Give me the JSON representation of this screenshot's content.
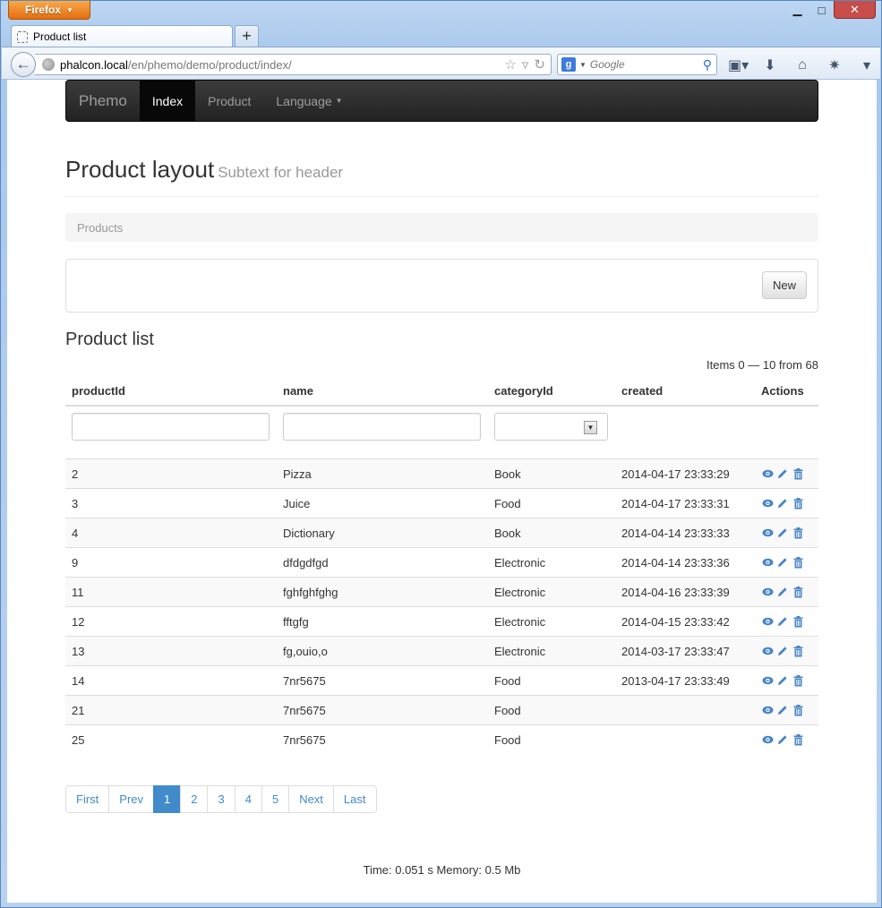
{
  "browser": {
    "menu_label": "Firefox",
    "tab_title": "Product list",
    "url_host": "phalcon.local",
    "url_path": "/en/phemo/demo/product/index/",
    "search_placeholder": "Google",
    "search_engine_letter": "g"
  },
  "navbar": {
    "brand": "Phemo",
    "items": [
      {
        "label": "Index",
        "active": true
      },
      {
        "label": "Product",
        "active": false
      },
      {
        "label": "Language",
        "active": false
      }
    ]
  },
  "header": {
    "title": "Product layout",
    "subtitle": "Subtext for header"
  },
  "breadcrumb": "Products",
  "toolbar": {
    "new_label": "New"
  },
  "list": {
    "title": "Product list",
    "items_info": "Items 0 — 10 from 68",
    "columns": [
      "productId",
      "name",
      "categoryId",
      "created",
      "Actions"
    ],
    "rows": [
      {
        "id": "2",
        "name": "Pizza",
        "category": "Book",
        "created": "2014-04-17 23:33:29"
      },
      {
        "id": "3",
        "name": "Juice",
        "category": "Food",
        "created": "2014-04-17 23:33:31"
      },
      {
        "id": "4",
        "name": "Dictionary",
        "category": "Book",
        "created": "2014-04-14 23:33:33"
      },
      {
        "id": "9",
        "name": "dfdgdfgd",
        "category": "Electronic",
        "created": "2014-04-14 23:33:36"
      },
      {
        "id": "11",
        "name": "fghfghfghg",
        "category": "Electronic",
        "created": "2014-04-16 23:33:39"
      },
      {
        "id": "12",
        "name": "fftgfg",
        "category": "Electronic",
        "created": "2014-04-15 23:33:42"
      },
      {
        "id": "13",
        "name": "fg,ouio,o",
        "category": "Electronic",
        "created": "2014-03-17 23:33:47"
      },
      {
        "id": "14",
        "name": "7nr5675",
        "category": "Food",
        "created": "2013-04-17 23:33:49"
      },
      {
        "id": "21",
        "name": "7nr5675",
        "category": "Food",
        "created": ""
      },
      {
        "id": "25",
        "name": "7nr5675",
        "category": "Food",
        "created": ""
      }
    ]
  },
  "pagination": {
    "first": "First",
    "prev": "Prev",
    "pages": [
      "1",
      "2",
      "3",
      "4",
      "5"
    ],
    "active_page": "1",
    "next": "Next",
    "last": "Last"
  },
  "footer": "Time: 0.051 s Memory: 0.5 Mb",
  "colors": {
    "link": "#428bca",
    "icon": "#4a86c5",
    "navbar_bg": "#222222"
  }
}
